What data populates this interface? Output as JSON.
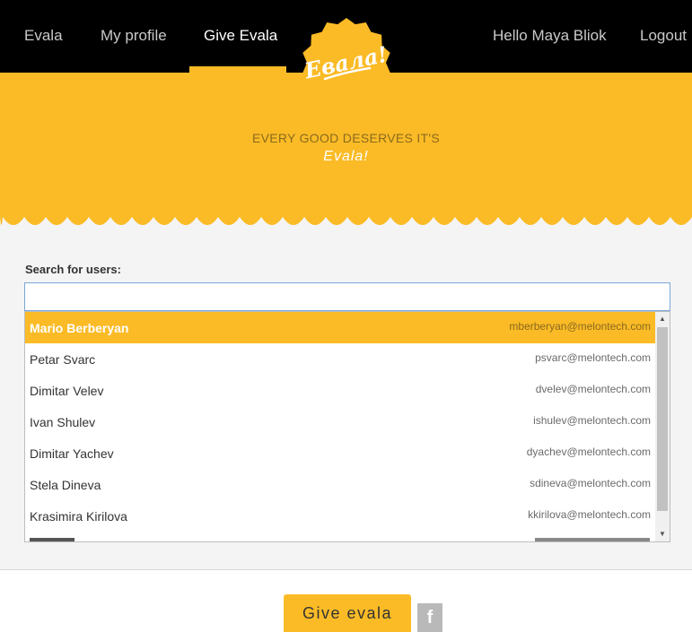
{
  "nav": {
    "brand": "Evala",
    "my_profile": "My profile",
    "give_evala": "Give Evala",
    "greeting": "Hello Maya Bliok",
    "logout": "Logout"
  },
  "logo": {
    "text": "Евала!"
  },
  "hero": {
    "line1": "EVERY GOOD DESERVES IT'S",
    "line2": "Evala!"
  },
  "search": {
    "label": "Search for users:",
    "value": "",
    "results": [
      {
        "name": "Mario Berberyan",
        "email": "mberberyan@melontech.com",
        "selected": true
      },
      {
        "name": "Petar Svarc",
        "email": "psvarc@melontech.com"
      },
      {
        "name": "Dimitar Velev",
        "email": "dvelev@melontech.com"
      },
      {
        "name": "Ivan Shulev",
        "email": "ishulev@melontech.com"
      },
      {
        "name": "Dimitar Yachev",
        "email": "dyachev@melontech.com"
      },
      {
        "name": "Stela Dineva",
        "email": "sdineva@melontech.com"
      },
      {
        "name": "Krasimira Kirilova",
        "email": "kkirilova@melontech.com"
      }
    ]
  },
  "actions": {
    "give_evala": "Give evala",
    "facebook": "f"
  },
  "colors": {
    "accent": "#fbbb26",
    "topbar": "#000000",
    "background": "#f4f4f4"
  }
}
